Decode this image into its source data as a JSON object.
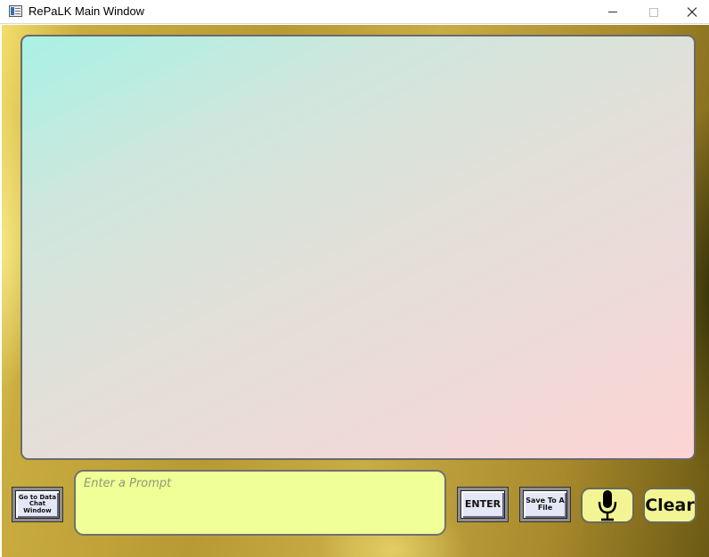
{
  "window": {
    "title": "RePaLK Main Window",
    "icon": "app-window-icon"
  },
  "display": {
    "content": ""
  },
  "buttons": {
    "datachat_label": "Go to Data Chat Window",
    "enter_label": "ENTER",
    "save_label": "Save To A File",
    "mic_icon": "microphone-icon",
    "clear_label": "Clear"
  },
  "prompt": {
    "placeholder": "Enter a Prompt",
    "value": ""
  },
  "colors": {
    "prompt_bg": "#f0ff96",
    "display_gradient_start": "#a8f2e4",
    "display_gradient_end": "#fdd4d4",
    "frame_gold": "#c9ac3e"
  }
}
